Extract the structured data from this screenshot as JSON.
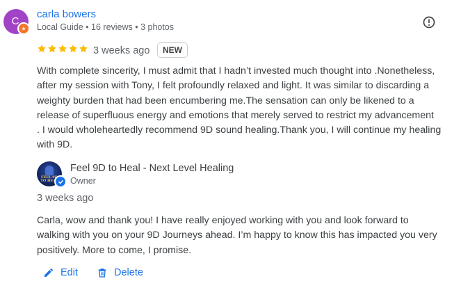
{
  "reviewer": {
    "avatar_letter": "C",
    "name": "carla bowers",
    "meta": "Local Guide • 16 reviews • 3 photos"
  },
  "review": {
    "rating": 5,
    "time": "3 weeks ago",
    "badge": "NEW",
    "text": "With complete sincerity, I must admit that I hadn’t invested much thought into .Nonetheless,\nafter my session with Tony, I felt profoundly relaxed and light. It was similar to discarding a\nweighty burden that had been encumbering me.The sensation can only be likened to a\nrelease of superfluous energy and emotions that merely served to restrict my advancement\n. I would wholeheartedly recommend 9D sound healing.Thank you, I will continue my healing\nwith 9D."
  },
  "owner_reply": {
    "logo_text": "FEEL 9D\nTO HEAL",
    "name": "Feel 9D to Heal - Next Level Healing",
    "role": "Owner",
    "time": "3 weeks ago",
    "text": "Carla, wow and thank you! I have really enjoyed working with you and look forward to\nwalking with you on your 9D Journeys ahead. I’m happy to know this has impacted you very\npositively. More to come, I promise."
  },
  "actions": {
    "edit_label": "Edit",
    "delete_label": "Delete"
  },
  "icons": {
    "report": "report-flag-icon",
    "star": "star-icon",
    "edit": "pencil-icon",
    "delete": "trash-icon",
    "verified": "verified-check-icon",
    "local_guide": "local-guide-star-icon"
  },
  "colors": {
    "accent": "#1a73e8",
    "avatar_bg": "#a142c7",
    "star": "#fbbc04",
    "local_guide_badge": "#f4772b"
  }
}
